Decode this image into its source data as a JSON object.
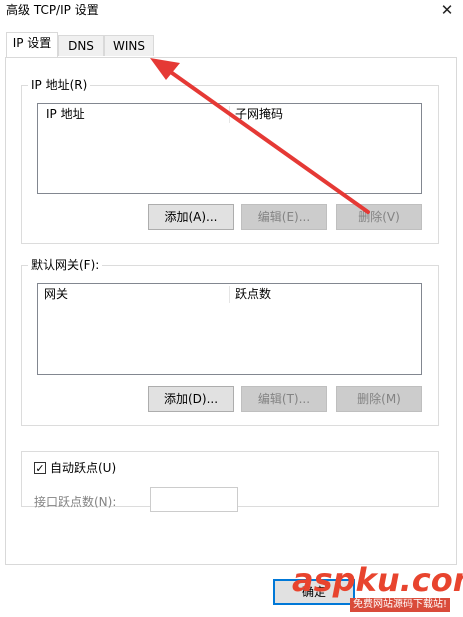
{
  "window": {
    "title": "高级 TCP/IP 设置",
    "close_glyph": "✕"
  },
  "tabs": [
    {
      "label": "IP 设置",
      "active": true
    },
    {
      "label": "DNS",
      "active": false
    },
    {
      "label": "WINS",
      "active": false
    }
  ],
  "ip_addresses": {
    "group_label": "IP 地址(R)",
    "columns": [
      "IP 地址",
      "子网掩码"
    ],
    "buttons": {
      "add": "添加(A)...",
      "edit": "编辑(E)...",
      "delete": "删除(V)"
    }
  },
  "default_gateways": {
    "group_label": "默认网关(F):",
    "columns": [
      "网关",
      "跃点数"
    ],
    "buttons": {
      "add": "添加(D)...",
      "edit": "编辑(T)...",
      "delete": "删除(M)"
    }
  },
  "automatic_metric": {
    "checkbox_label": "自动跃点(U)",
    "checked": true,
    "check_glyph": "✓",
    "interface_metric_label": "接口跃点数(N):",
    "interface_metric_value": ""
  },
  "footer": {
    "ok_label": "确定"
  },
  "annotation": {
    "arrow_color": "#e53935"
  },
  "watermark": {
    "brand": "aspku.com",
    "subtitle": "免费网站源码下载站!"
  }
}
